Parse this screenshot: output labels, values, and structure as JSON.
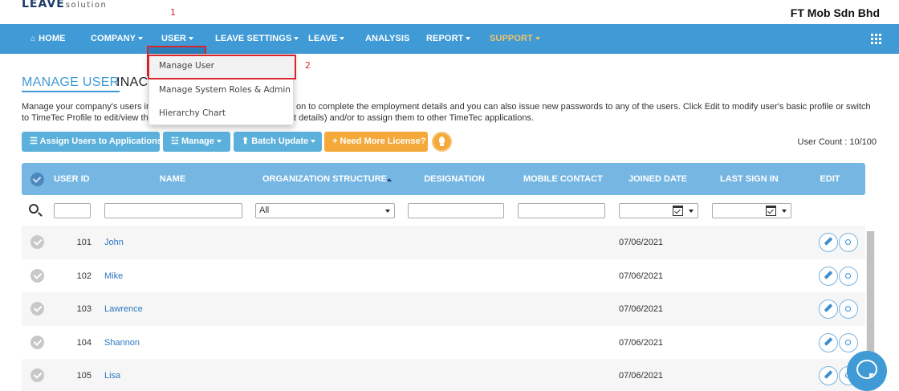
{
  "header": {
    "logo_main": "LEAVE",
    "logo_sub": "solution",
    "company_name": "FT Mob Sdn Bhd"
  },
  "nav": {
    "home": "HOME",
    "company": "COMPANY",
    "user": "USER",
    "leave_settings": "LEAVE SETTINGS",
    "leave": "LEAVE",
    "analysis": "ANALYSIS",
    "report": "REPORT",
    "support": "SUPPORT"
  },
  "annotations": {
    "step1": "1",
    "step2": "2"
  },
  "user_menu": {
    "items": [
      "Manage User",
      "Manage System Roles & Admin",
      "Hierarchy Chart"
    ]
  },
  "tabs": {
    "manage_user": "MANAGE USER",
    "inactive": "INACT"
  },
  "description": {
    "line1_a": "Manage your company's users in",
    "line1_b": "on to complete the employment details and you can also issue new passwords to any of the users. Click Edit to modify user's basic profile or switch",
    "line2_a": "to TimeTec Profile to edit/view th",
    "line2_b": "t details) and/or to assign them to other TimeTec applications."
  },
  "toolbar": {
    "assign": "Assign Users to Applications",
    "manage": "Manage",
    "batch_update": "Batch Update",
    "need_license": "Need More License?",
    "user_count": "User Count : 10/100"
  },
  "table": {
    "columns": {
      "user_id": "USER ID",
      "name": "NAME",
      "org_structure": "ORGANIZATION STRUCTURE",
      "designation": "DESIGNATION",
      "mobile": "MOBILE CONTACT",
      "joined": "JOINED DATE",
      "last_sign_in": "LAST SIGN IN",
      "edit": "EDIT"
    },
    "filter": {
      "org_selected": "All"
    },
    "rows": [
      {
        "id": "101",
        "name": "John",
        "joined": "07/06/2021"
      },
      {
        "id": "102",
        "name": "Mike",
        "joined": "07/06/2021"
      },
      {
        "id": "103",
        "name": "Lawrence",
        "joined": "07/06/2021"
      },
      {
        "id": "104",
        "name": "Shannon",
        "joined": "07/06/2021"
      },
      {
        "id": "105",
        "name": "Lisa",
        "joined": "07/06/2021"
      }
    ]
  },
  "colors": {
    "nav_bg": "#3f9ad6",
    "accent": "#3f9ad6",
    "highlight_box": "#d9262c",
    "table_header": "#75b6e3",
    "license_button": "#f4a93a",
    "support_text": "#f1c36a"
  }
}
